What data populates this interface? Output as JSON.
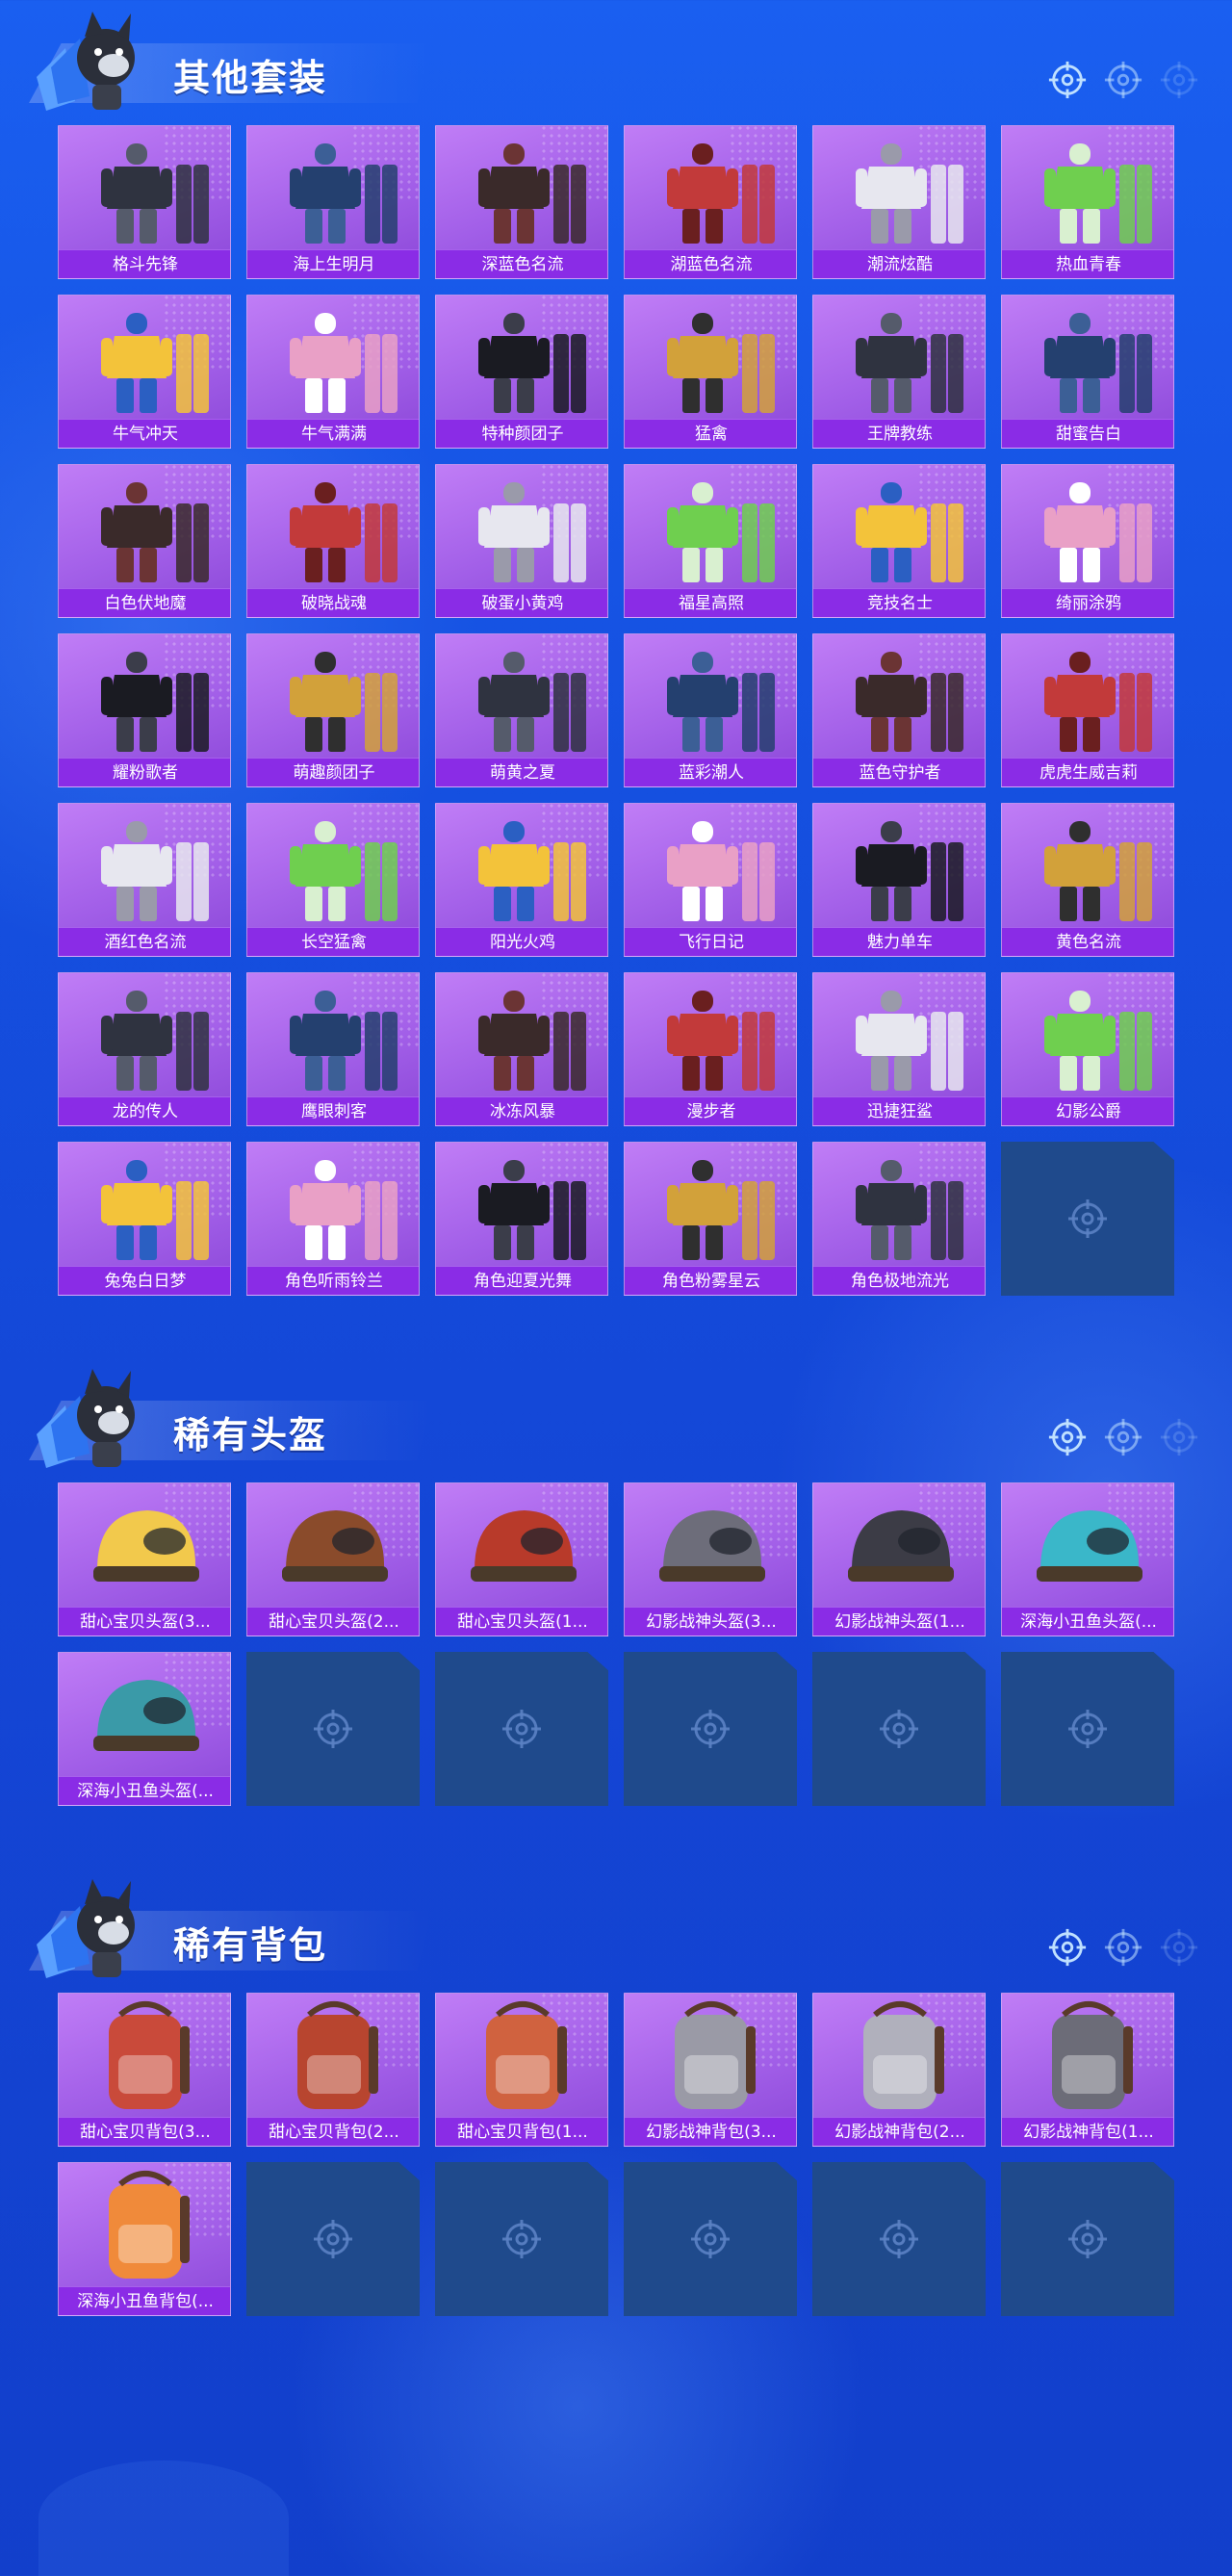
{
  "sections": [
    {
      "title": "其他套装",
      "items": [
        "格斗先锋",
        "海上生明月",
        "深蓝色名流",
        "湖蓝色名流",
        "潮流炫酷",
        "热血青春",
        "牛气冲天",
        "牛气满满",
        "特种颜团子",
        "猛禽",
        "王牌教练",
        "甜蜜告白",
        "白色伏地魔",
        "破晓战魂",
        "破蛋小黄鸡",
        "福星高照",
        "竞技名士",
        "绮丽涂鸦",
        "耀粉歌者",
        "萌趣颜团子",
        "萌黄之夏",
        "蓝彩潮人",
        "蓝色守护者",
        "虎虎生威吉莉",
        "酒红色名流",
        "长空猛禽",
        "阳光火鸡",
        "飞行日记",
        "魅力单车",
        "黄色名流",
        "龙的传人",
        "鹰眼刺客",
        "冰冻风暴",
        "漫步者",
        "迅捷狂鲨",
        "幻影公爵",
        "兔兔白日梦",
        "角色听雨铃兰",
        "角色迎夏光舞",
        "角色粉雾星云",
        "角色极地流光"
      ],
      "empty_slots": 1
    },
    {
      "title": "稀有头盔",
      "items": [
        "甜心宝贝头盔(3...",
        "甜心宝贝头盔(2...",
        "甜心宝贝头盔(1...",
        "幻影战神头盔(3...",
        "幻影战神头盔(1...",
        "深海小丑鱼头盔(...",
        "深海小丑鱼头盔(..."
      ],
      "empty_slots": 5
    },
    {
      "title": "稀有背包",
      "items": [
        "甜心宝贝背包(3...",
        "甜心宝贝背包(2...",
        "甜心宝贝背包(1...",
        "幻影战神背包(3...",
        "幻影战神背包(2...",
        "幻影战神背包(1...",
        "深海小丑鱼背包(..."
      ],
      "empty_slots": 5
    }
  ],
  "icons": {
    "mascot": "wolf-mascot-icon",
    "crosshair": "crosshair-icon",
    "empty_slot": "crosshair-placeholder-icon"
  },
  "colors": {
    "background": "#1550e0",
    "card": "#a25fe8",
    "card_label": "#8a2ce6",
    "empty_slot": "#1f4a8c"
  }
}
